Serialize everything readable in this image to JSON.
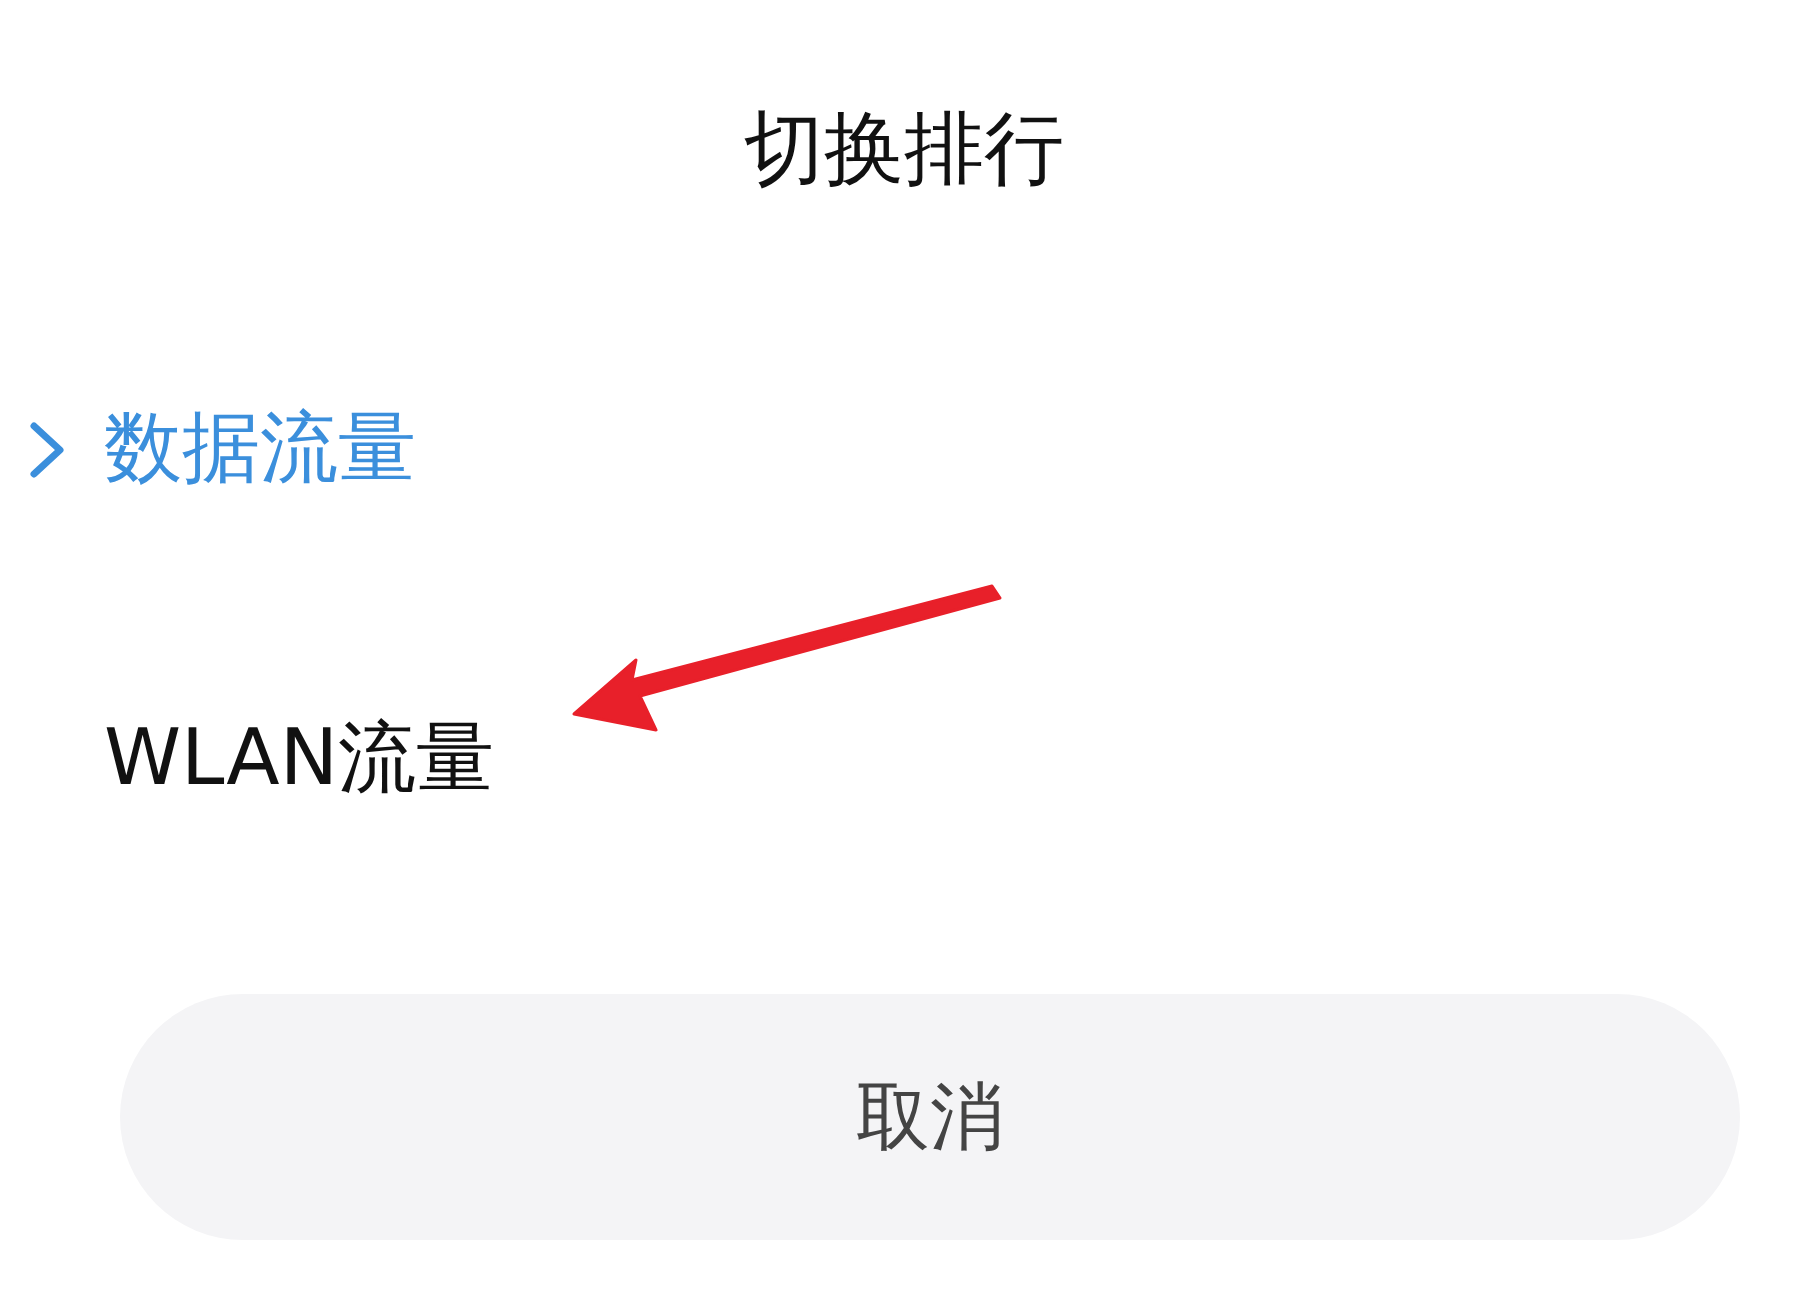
{
  "title": "切换排行",
  "options": [
    {
      "label": "数据流量",
      "selected": true
    },
    {
      "label": "WLAN流量",
      "selected": false
    }
  ],
  "cancel_button": {
    "label": "取消"
  },
  "annotations": [
    {
      "kind": "arrow"
    }
  ]
}
